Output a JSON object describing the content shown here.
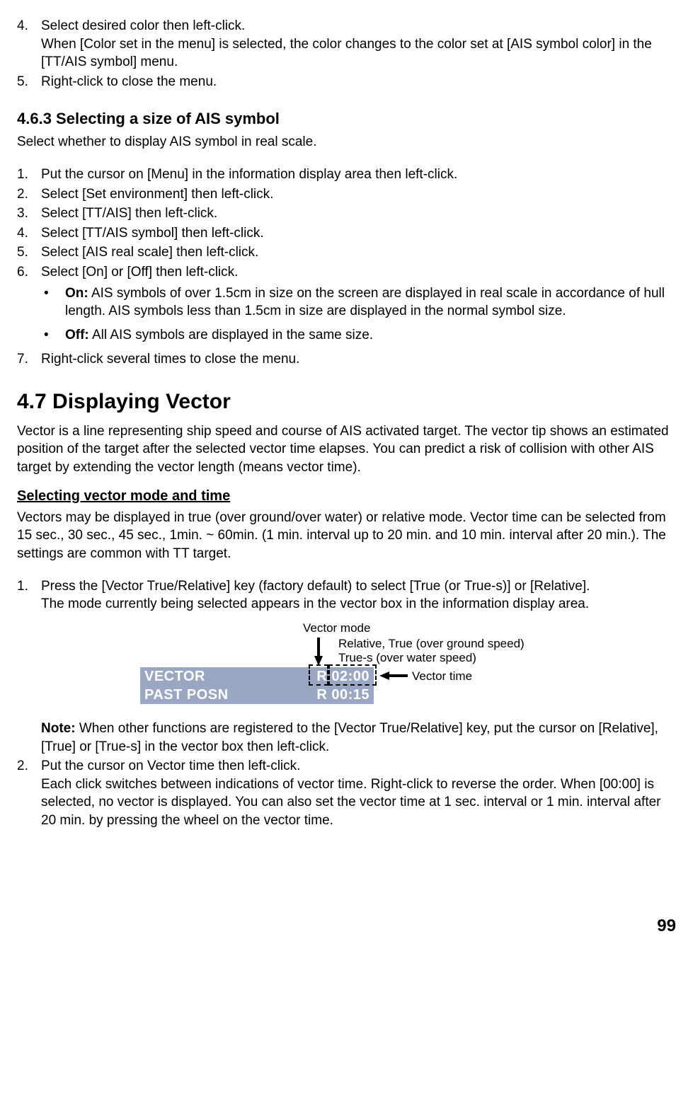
{
  "top": {
    "item4_num": "4.",
    "item4_a": "Select desired color then left-click.",
    "item4_b": "When [Color set in the menu] is selected, the color changes to the color set at [AIS symbol color] in the [TT/AIS symbol] menu.",
    "item5_num": "5.",
    "item5": "Right-click to close the menu."
  },
  "s463": {
    "heading": "4.6.3 Selecting a size of AIS symbol",
    "intro": "Select whether to display AIS symbol in real scale.",
    "steps": {
      "n1": "1.",
      "t1": "Put the cursor on [Menu] in the information display area then left-click.",
      "n2": "2.",
      "t2": "Select [Set environment] then left-click.",
      "n3": "3.",
      "t3": "Select [TT/AIS] then left-click.",
      "n4": "4.",
      "t4": "Select [TT/AIS symbol] then left-click.",
      "n5": "5.",
      "t5": "Select [AIS real scale] then left-click.",
      "n6": "6.",
      "t6": "Select [On] or [Off] then left-click."
    },
    "on_label": "On:",
    "on_text": " AIS symbols of over 1.5cm in size on the screen are displayed in real scale in accordance of hull length. AIS symbols less than 1.5cm in size are displayed in the normal symbol size.",
    "off_label": "Off:",
    "off_text": " All AIS symbols are displayed in the same size.",
    "n7": "7.",
    "t7": "Right-click several times to close the menu."
  },
  "s47": {
    "heading": "4.7  Displaying Vector",
    "intro": "Vector is a line representing ship speed and course of AIS activated target. The vector tip shows an estimated position of the target after the selected vector time elapses. You can predict a risk of collision with other AIS target by extending the vector length (means vector time).",
    "sub": "Selecting vector mode and time",
    "sub_text": "Vectors may be displayed in true (over ground/over water) or relative mode. Vector time can be selected from 15 sec., 30 sec., 45 sec., 1min. ~ 60min. (1 min. interval up to 20 min. and 10 min. interval after 20 min.). The settings are common with TT target.",
    "n1": "1.",
    "t1a": "Press the [Vector True/Relative] key (factory default) to select [True (or True-s)] or [Relative].",
    "t1b": "The mode currently being selected appears in the vector box in the information display area.",
    "fig": {
      "vector_mode_label": "Vector mode",
      "mode_desc1": "Relative, True (over ground speed)",
      "mode_desc2": "True-s (over water speed)",
      "vector_time_label": "Vector time",
      "box_line1_left": "VECTOR",
      "box_line1_right_mode": "R",
      "box_line1_right_time": "02:00",
      "box_line2_left": "PAST POSN",
      "box_line2_right_mode": "R",
      "box_line2_right_time": "00:15"
    },
    "note_label": "Note:",
    "note_text": " When other functions are registered to the [Vector True/Relative] key, put the cursor on [Relative], [True] or [True-s] in the vector box then left-click.",
    "n2": "2.",
    "t2a": " Put the cursor on Vector time then left-click.",
    "t2b": "Each click switches between indications of vector time. Right-click to reverse the order. When [00:00] is selected, no vector is displayed. You can also set the vector time at 1 sec. interval or 1 min. interval after 20 min. by pressing the wheel on the vector time."
  },
  "page_number": "99"
}
